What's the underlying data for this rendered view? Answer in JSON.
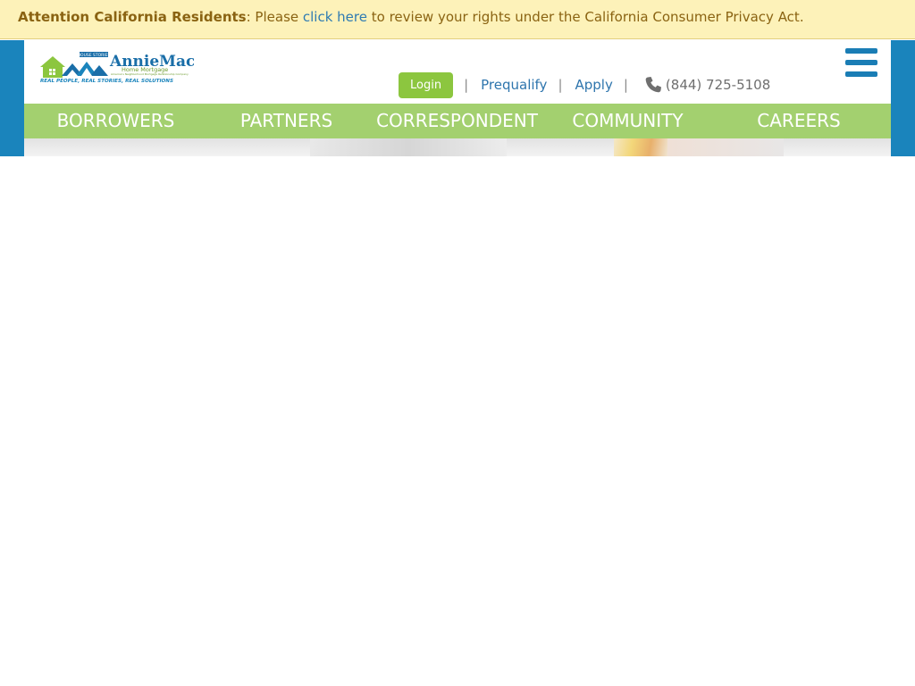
{
  "notice": {
    "bold": "Attention California Residents",
    "pre": ": Please ",
    "link": "click here",
    "post": " to review your rights under the California Consumer Privacy Act."
  },
  "logo": {
    "brand": "AnnieMac",
    "sub": "Home Mortgage",
    "badge": "HOUSE STORIES",
    "fine": "America's Neighborhood Mortgage Relationship Company",
    "tagline": "REAL PEOPLE, REAL STORIES, REAL SOLUTIONS"
  },
  "utility": {
    "login": "Login",
    "separator": "|",
    "prequalify": "Prequalify",
    "apply": "Apply",
    "phone": "(844) 725-5108"
  },
  "nav": {
    "borrowers": "BORROWERS",
    "partners": "PARTNERS",
    "correspondent": "CORRESPONDENT",
    "community": "COMMUNITY",
    "careers": "CAREERS"
  },
  "icons": {
    "phone": "phone-icon",
    "menu": "hamburger-menu-icon"
  },
  "colors": {
    "notice_bg": "#fdf2b9",
    "notice_text": "#8a6312",
    "link": "#2e75ad",
    "brand_blue": "#1a84bc",
    "nav_green": "#a3d06f",
    "login_green": "#8cc63f"
  }
}
